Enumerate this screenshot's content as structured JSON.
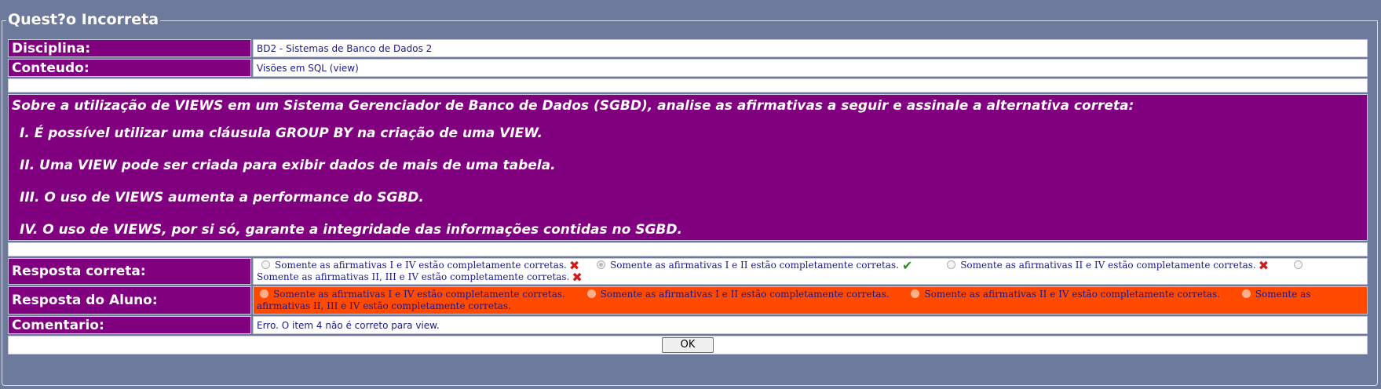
{
  "legend": "Quest?o Incorreta",
  "rows": {
    "disciplina_label": "Disciplina:",
    "disciplina_value": "BD2 - Sistemas de Banco de Dados 2",
    "conteudo_label": "Conteudo:",
    "conteudo_value": "Visões em SQL (view)",
    "resposta_correta_label": "Resposta correta:",
    "resposta_aluno_label": "Resposta do Aluno:",
    "comentario_label": "Comentario:",
    "comentario_value": "Erro. O item 4 não é correto para view."
  },
  "question": {
    "intro": "Sobre a utilização de VIEWS em um Sistema Gerenciador de Banco de Dados (SGBD), analise as afirmativas a seguir e assinale a alternativa correta:",
    "items": [
      "I.  É possível utilizar uma cláusula GROUP BY na criação de uma VIEW.",
      "II. Uma VIEW pode ser criada para exibir dados de mais de uma tabela.",
      "III. O uso de VIEWS aumenta a performance do SGBD.",
      "IV. O uso de VIEWS, por si só, garante a integridade das informações contidas no SGBD."
    ]
  },
  "options": [
    "Somente as afirmativas I e IV estão completamente corretas.",
    "Somente as afirmativas I e II estão completamente corretas.",
    "Somente as afirmativas II e IV estão completamente corretas.",
    "Somente as afirmativas II, III e IV estão completamente corretas."
  ],
  "correct_marks": [
    "x-icon",
    "check-icon",
    "x-icon",
    "x-icon"
  ],
  "selected_correct_index": 1,
  "ok_button": "OK",
  "colors": {
    "background": "#6e7a9c",
    "label_bg": "#800080",
    "student_bg": "#ff4a00",
    "value_text": "#1a1a8c"
  }
}
